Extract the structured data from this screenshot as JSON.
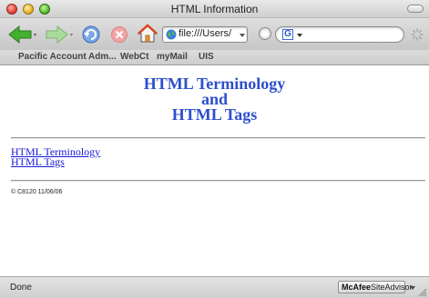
{
  "window": {
    "title": "HTML Information"
  },
  "toolbar": {
    "url_value": "file:///Users/",
    "icons": [
      "back-arrow-icon",
      "forward-arrow-icon",
      "reload-icon",
      "stop-icon",
      "home-icon",
      "globe-icon",
      "google-icon",
      "spinner-icon"
    ]
  },
  "bookmarks": [
    {
      "label": "Pacific Account Adm..."
    },
    {
      "label": "WebCt"
    },
    {
      "label": "myMail"
    },
    {
      "label": "UIS"
    }
  ],
  "page": {
    "heading": [
      "HTML Terminology",
      "and",
      "HTML Tags"
    ],
    "links": [
      "HTML Terminology",
      "HTML Tags"
    ],
    "footer_note": "© C8120 11/06/06"
  },
  "status": {
    "text": "Done",
    "siteadvisor_brand": "McAfee",
    "siteadvisor_product": "SiteAdvisor"
  },
  "colors": {
    "heading": "#2d4fcc",
    "link": "#1a1adb",
    "toolbar_green_arrow": "#3aa52a"
  }
}
